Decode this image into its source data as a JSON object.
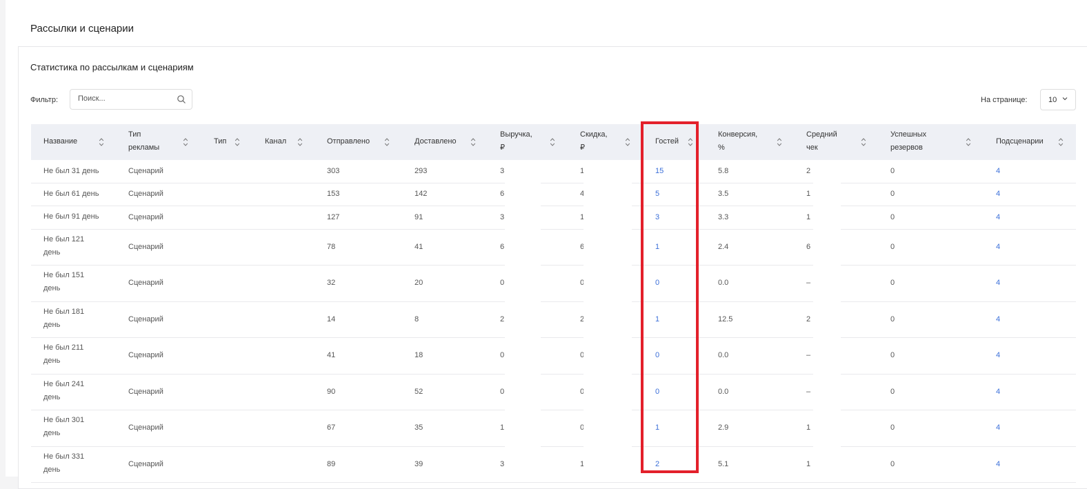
{
  "page": {
    "title": "Рассылки и сценарии"
  },
  "card": {
    "title": "Статистика по рассылкам и сценариям"
  },
  "filter": {
    "label": "Фильтр:",
    "placeholder": "Поиск..."
  },
  "per_page": {
    "label": "На странице:",
    "value": "10"
  },
  "columns": [
    [
      "Название"
    ],
    [
      "Тип",
      "рекламы"
    ],
    [
      "Тип"
    ],
    [
      "Канал"
    ],
    [
      "Отправлено"
    ],
    [
      "Доставлено"
    ],
    [
      "Выручка,",
      "₽"
    ],
    [
      "Скидка,",
      "₽"
    ],
    [
      "Гостей"
    ],
    [
      "Конверсия,",
      "%"
    ],
    [
      "Средний",
      "чек"
    ],
    [
      "Успешных",
      "резервов"
    ],
    [
      "Подсценарии"
    ]
  ],
  "rows": [
    {
      "name": [
        "Не был 31 день"
      ],
      "ad_type": "Сценарий",
      "type": "",
      "channel": "",
      "sent": "303",
      "delivered": "293",
      "revenue": "3",
      "discount": "1",
      "guests": "15",
      "conversion": "5.8",
      "avg_check": "2",
      "reserves": "0",
      "subs": "4"
    },
    {
      "name": [
        "Не был 61 день"
      ],
      "ad_type": "Сценарий",
      "type": "",
      "channel": "",
      "sent": "153",
      "delivered": "142",
      "revenue": "6",
      "discount": "4",
      "guests": "5",
      "conversion": "3.5",
      "avg_check": "1",
      "reserves": "0",
      "subs": "4"
    },
    {
      "name": [
        "Не был 91 день"
      ],
      "ad_type": "Сценарий",
      "type": "",
      "channel": "",
      "sent": "127",
      "delivered": "91",
      "revenue": "3",
      "discount": "1",
      "guests": "3",
      "conversion": "3.3",
      "avg_check": "1",
      "reserves": "0",
      "subs": "4"
    },
    {
      "name": [
        "Не был 121",
        "день"
      ],
      "ad_type": "Сценарий",
      "type": "",
      "channel": "",
      "sent": "78",
      "delivered": "41",
      "revenue": "6",
      "discount": "6",
      "guests": "1",
      "conversion": "2.4",
      "avg_check": "6",
      "reserves": "0",
      "subs": "4"
    },
    {
      "name": [
        "Не был 151",
        "день"
      ],
      "ad_type": "Сценарий",
      "type": "",
      "channel": "",
      "sent": "32",
      "delivered": "20",
      "revenue": "0",
      "discount": "0",
      "guests": "0",
      "conversion": "0.0",
      "avg_check": "–",
      "reserves": "0",
      "subs": "4"
    },
    {
      "name": [
        "Не был 181",
        "день"
      ],
      "ad_type": "Сценарий",
      "type": "",
      "channel": "",
      "sent": "14",
      "delivered": "8",
      "revenue": "2",
      "discount": "2",
      "guests": "1",
      "conversion": "12.5",
      "avg_check": "2",
      "reserves": "0",
      "subs": "4"
    },
    {
      "name": [
        "Не был 211",
        "день"
      ],
      "ad_type": "Сценарий",
      "type": "",
      "channel": "",
      "sent": "41",
      "delivered": "18",
      "revenue": "0",
      "discount": "0",
      "guests": "0",
      "conversion": "0.0",
      "avg_check": "–",
      "reserves": "0",
      "subs": "4"
    },
    {
      "name": [
        "Не был 241",
        "день"
      ],
      "ad_type": "Сценарий",
      "type": "",
      "channel": "",
      "sent": "90",
      "delivered": "52",
      "revenue": "0",
      "discount": "0",
      "guests": "0",
      "conversion": "0.0",
      "avg_check": "–",
      "reserves": "0",
      "subs": "4"
    },
    {
      "name": [
        "Не был 301",
        "день"
      ],
      "ad_type": "Сценарий",
      "type": "",
      "channel": "",
      "sent": "67",
      "delivered": "35",
      "revenue": "1",
      "discount": "0",
      "guests": "1",
      "conversion": "2.9",
      "avg_check": "1",
      "reserves": "0",
      "subs": "4"
    },
    {
      "name": [
        "Не был 331",
        "день"
      ],
      "ad_type": "Сценарий",
      "type": "",
      "channel": "",
      "sent": "89",
      "delivered": "39",
      "revenue": "3",
      "discount": "1",
      "guests": "2",
      "conversion": "5.1",
      "avg_check": "1",
      "reserves": "0",
      "subs": "4"
    }
  ],
  "theme": {
    "accent": "#3b6fd9",
    "highlight": "#e3202b",
    "header_bg": "#eef0f5"
  },
  "icons": {
    "search": "search-icon",
    "sort": "sort-icon",
    "dropdown": "chevron-down-icon"
  }
}
